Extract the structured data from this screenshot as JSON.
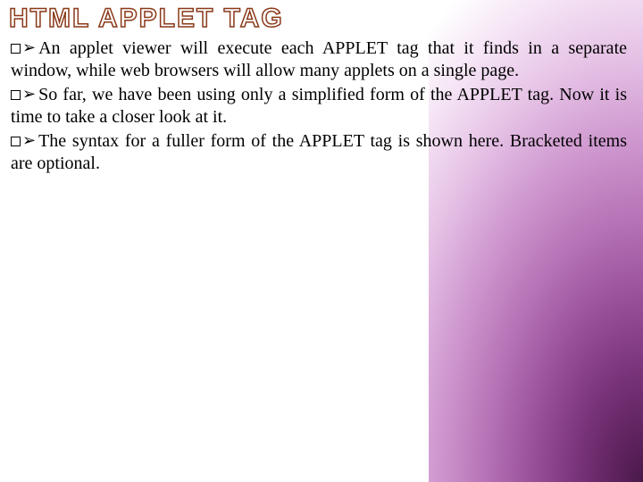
{
  "title": "HTML APPLET TAG",
  "bullets": [
    "An applet viewer will execute each APPLET tag that it finds in a separate window, while web browsers will allow many applets on a single page.",
    "So far, we have been using only a simplified form of the APPLET tag. Now it is time to take a closer look at it.",
    "The syntax for a fuller form of the APPLET tag is shown here. Bracketed items are optional."
  ]
}
